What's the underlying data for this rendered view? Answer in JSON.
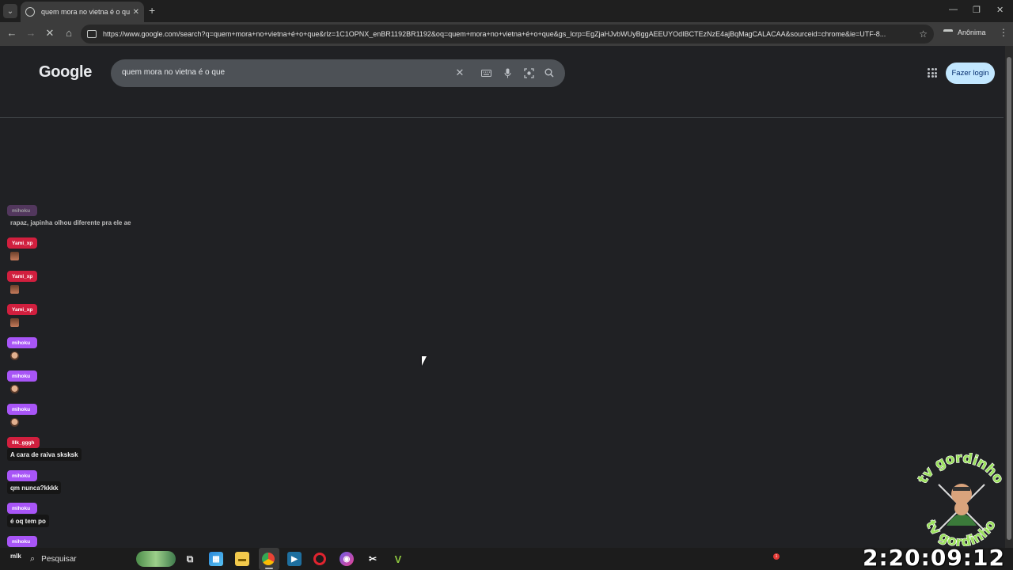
{
  "browser": {
    "tab_title": "quem mora no vietna é o que",
    "new_tab": "+",
    "url": "https://www.google.com/search?q=quem+mora+no+vietna+é+o+que&rlz=1C1OPNX_enBR1192BR1192&oq=quem+mora+no+vietna+é+o+que&gs_lcrp=EgZjaHJvbWUyBggAEEUYOdIBCTEzNzE4ajBqMagCALACAA&sourceid=chrome&ie=UTF-8...",
    "profile_label": "Anônima",
    "window_controls": [
      "—",
      "❐",
      "✕"
    ]
  },
  "google": {
    "logo": "Google",
    "query": "quem mora no vietna é o que",
    "login_label": "Fazer login",
    "icons": [
      "clear-icon",
      "keyboard-icon",
      "mic-icon",
      "lens-icon",
      "search-icon",
      "apps-icon"
    ]
  },
  "chat": {
    "messages": [
      {
        "user": "mihoku",
        "text": "rapaz, japinha olhou diferente pra ele ae",
        "color": "faded",
        "emote": false
      },
      {
        "user": "Yami_xp",
        "text": "",
        "color": "red",
        "emote": "face1"
      },
      {
        "user": "Yami_xp",
        "text": "",
        "color": "red",
        "emote": "face1"
      },
      {
        "user": "Yami_xp",
        "text": "",
        "color": "red",
        "emote": "face1"
      },
      {
        "user": "mihoku",
        "text": "",
        "color": "purple",
        "emote": "face2"
      },
      {
        "user": "mihoku",
        "text": "",
        "color": "purple",
        "emote": "face2"
      },
      {
        "user": "mihoku",
        "text": "",
        "color": "purple",
        "emote": "face2"
      },
      {
        "user": "lllk_gggh",
        "text": "A cara de raiva sksksk",
        "color": "red",
        "emote": false
      },
      {
        "user": "mihoku",
        "text": "qm nunca?kkkk",
        "color": "purple",
        "emote": false
      },
      {
        "user": "mihoku",
        "text": "é oq tem po",
        "color": "purple",
        "emote": false
      },
      {
        "user": "mihoku",
        "text": "mlk",
        "color": "purple",
        "emote": false
      }
    ]
  },
  "taskbar": {
    "search_label": "Pesquisar",
    "notification_count": "1",
    "clock": "2:20:09:12"
  },
  "overlay": {
    "logo_text": "tv gordinho"
  },
  "colors": {
    "page_bg": "#202124",
    "searchbox_bg": "#4d5156",
    "login_bg": "#c2e7ff",
    "chat_red": "#d11f3e",
    "chat_purple": "#a855f7"
  }
}
